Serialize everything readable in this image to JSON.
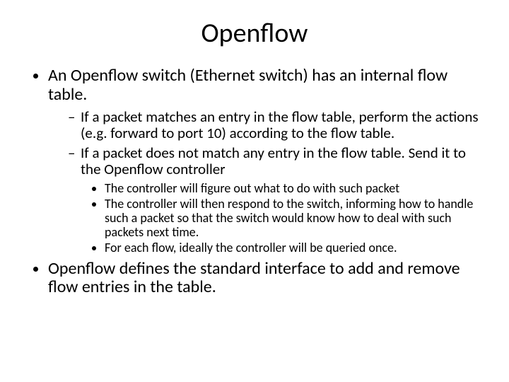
{
  "title": "Openflow",
  "bullets": {
    "b1": "An Openflow switch (Ethernet switch) has an internal flow table.",
    "b1_1": "If a packet matches an entry in the flow table, perform the actions (e.g. forward to port 10) according to the flow table.",
    "b1_2": "If a packet does not match any entry in the flow table. Send it to the Openflow controller",
    "b1_2_1": "The controller will figure out what to do with such packet",
    "b1_2_2": "The controller will then respond to the switch, informing how to handle such a packet so that the switch would know how to deal with such packets next time.",
    "b1_2_3": "For each flow, ideally the controller will be queried once.",
    "b2": "Openflow defines the standard interface to add and remove flow entries in the table."
  }
}
